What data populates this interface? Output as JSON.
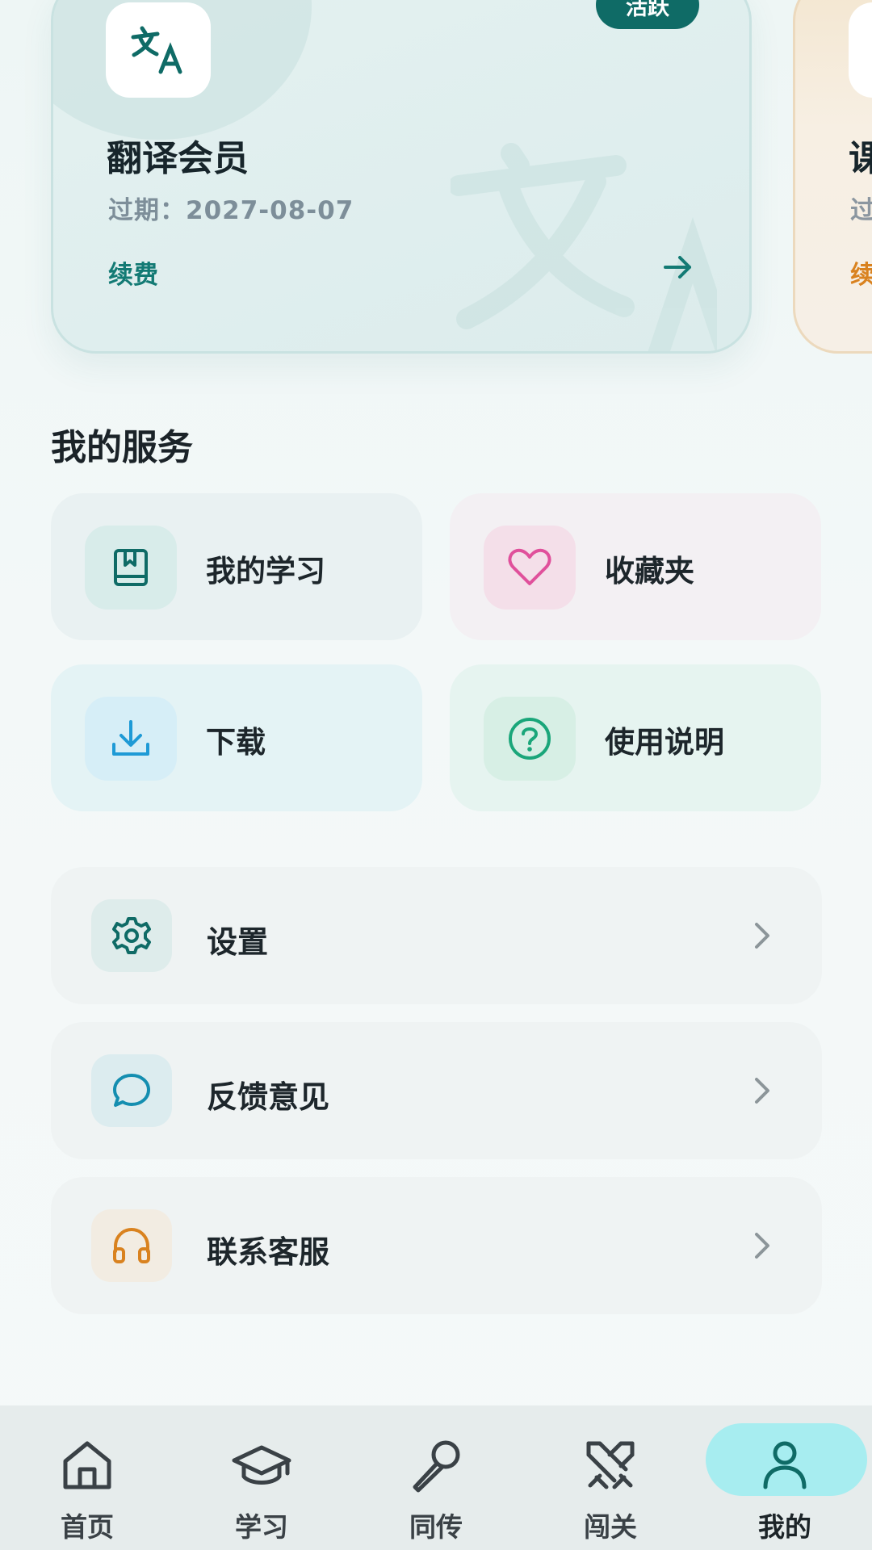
{
  "membership_cards": [
    {
      "title": "翻译会员",
      "expiry": "过期：2027-08-07",
      "renew_label": "续费",
      "badge": "活跃",
      "accent": "#0f6b66"
    },
    {
      "title": "课",
      "expiry": "过",
      "renew_label": "续",
      "accent": "#d9821f"
    }
  ],
  "services": {
    "title": "我的服务",
    "tiles": [
      {
        "label": "我的学习",
        "icon": "book-icon",
        "color": "#0f6b66"
      },
      {
        "label": "收藏夹",
        "icon": "heart-icon",
        "color": "#e0509b"
      },
      {
        "label": "下载",
        "icon": "download-icon",
        "color": "#1e9ad6"
      },
      {
        "label": "使用说明",
        "icon": "help-icon",
        "color": "#1aa67a"
      }
    ]
  },
  "settings_list": [
    {
      "label": "设置",
      "icon": "gear-icon",
      "color": "#0f6b66"
    },
    {
      "label": "反馈意见",
      "icon": "chat-icon",
      "color": "#148eb0"
    },
    {
      "label": "联系客服",
      "icon": "headphones-icon",
      "color": "#d9821f"
    }
  ],
  "bottom_nav": [
    {
      "label": "首页",
      "icon": "home-icon"
    },
    {
      "label": "学习",
      "icon": "graduation-cap-icon"
    },
    {
      "label": "同传",
      "icon": "microphone-icon"
    },
    {
      "label": "闯关",
      "icon": "crossed-swords-icon"
    },
    {
      "label": "我的",
      "icon": "user-icon",
      "active": true
    }
  ]
}
